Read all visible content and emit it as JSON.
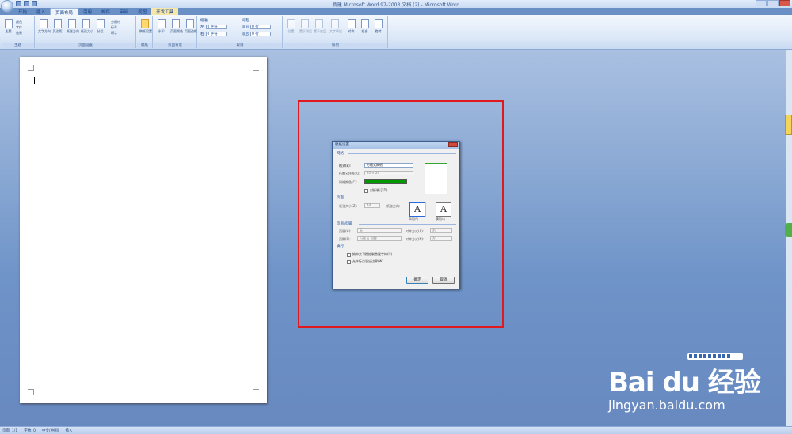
{
  "window": {
    "title": "新建 Microsoft Word 97-2003 文档 (2) - Microsoft Word"
  },
  "tabs": [
    "开始",
    "插入",
    "页面布局",
    "引用",
    "邮件",
    "审阅",
    "视图",
    "开发工具"
  ],
  "active_tab": "页面布局",
  "ribbon": {
    "groups": [
      {
        "label": "主题",
        "buttons": [
          "主题"
        ],
        "small": [
          "颜色",
          "字体",
          "效果"
        ]
      },
      {
        "label": "页面设置",
        "buttons": [
          "文字方向",
          "页边距",
          "纸张方向",
          "纸张大小",
          "分栏"
        ],
        "small": [
          "分隔符",
          "行号",
          "断字"
        ]
      },
      {
        "label": "稿纸",
        "buttons": [
          "稿纸设置"
        ]
      },
      {
        "label": "页面背景",
        "buttons": [
          "水印",
          "页面颜色",
          "页面边框"
        ]
      },
      {
        "label": "段落",
        "indent_title": "缩进",
        "spacing_title": "间距",
        "indent_left_label": "左",
        "indent_left": "0 字符",
        "indent_right_label": "右",
        "indent_right": "0 字符",
        "space_before_label": "段前",
        "space_before": "0 行",
        "space_after_label": "段后",
        "space_after": "0 行"
      },
      {
        "label": "排列",
        "buttons": [
          "位置",
          "置于顶层",
          "置于底层",
          "文字环绕",
          "对齐",
          "组合",
          "旋转"
        ]
      }
    ]
  },
  "dialog": {
    "title": "稿纸设置",
    "section_grid": "网格",
    "format_label": "格式(E):",
    "format_value": "方格式稿纸",
    "rows_cols_label": "行数×列数(R):",
    "rows_cols_value": "20 × 20",
    "grid_color_label": "网格颜色(C):",
    "grid_color": "#009900",
    "fold_label": "对折装订(D)",
    "section_page": "页面",
    "paper_size_label": "纸张大小(Z):",
    "paper_size_value": "A4",
    "orientation_label": "纸张方向:",
    "portrait_label": "纵向(P)",
    "landscape_label": "横向(L)",
    "section_header": "页眉/页脚",
    "header_label": "页眉(H):",
    "header_value": "无",
    "footer_label": "页脚(F):",
    "footer_value": "行数 × 列数",
    "align1_label": "对齐方式(A):",
    "align1_value": "右",
    "align2_label": "对齐方式(N):",
    "align2_value": "左",
    "section_layout": "换行",
    "opt1_label": "按中文习惯控制首尾字符(U)",
    "opt2_label": "允许标点溢出边界(W)",
    "ok_label": "确定",
    "cancel_label": "取消"
  },
  "statusbar": {
    "page": "页面: 1/1",
    "words": "字数: 0",
    "language": "中文(中国)",
    "mode": "插入"
  },
  "watermark": {
    "brand": "Bai du 经验",
    "url": "jingyan.baidu.com"
  },
  "colors": {
    "annotation_box": "#e0191e",
    "doc_background": "#6a8fc4"
  }
}
